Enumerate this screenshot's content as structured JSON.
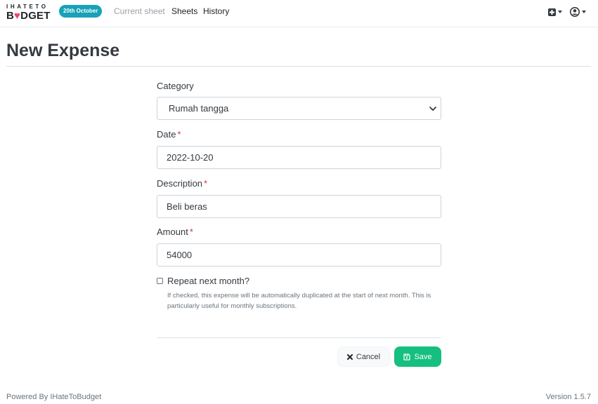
{
  "navbar": {
    "logo_top": "IHATETO",
    "logo_b": "B",
    "logo_heart": "♥",
    "logo_rest": "DGET",
    "date_badge": "20th October",
    "links": {
      "current_sheet": "Current sheet",
      "sheets": "Sheets",
      "history": "History"
    },
    "icons": {
      "add": "plus-square-icon",
      "user": "user-circle-icon"
    }
  },
  "page": {
    "title": "New Expense"
  },
  "form": {
    "category": {
      "label": "Category",
      "value": "Rumah tangga"
    },
    "date": {
      "label": "Date",
      "required_mark": "*",
      "value": "2022-10-20"
    },
    "description": {
      "label": "Description",
      "required_mark": "*",
      "value": "Beli beras"
    },
    "amount": {
      "label": "Amount",
      "required_mark": "*",
      "value": "54000"
    },
    "repeat": {
      "label": "Repeat next month?",
      "checked": false,
      "help": "If checked, this expense will be automatically duplicated at the start of next month. This is particularly useful for monthly subscriptions."
    },
    "buttons": {
      "cancel": "Cancel",
      "save": "Save"
    }
  },
  "footer": {
    "left": "Powered By IHateToBudget",
    "right": "Version 1.5.7"
  },
  "colors": {
    "badge": "#17a2b8",
    "save": "#15bf7f",
    "required": "#dc3545",
    "heart": "#e8466b"
  }
}
